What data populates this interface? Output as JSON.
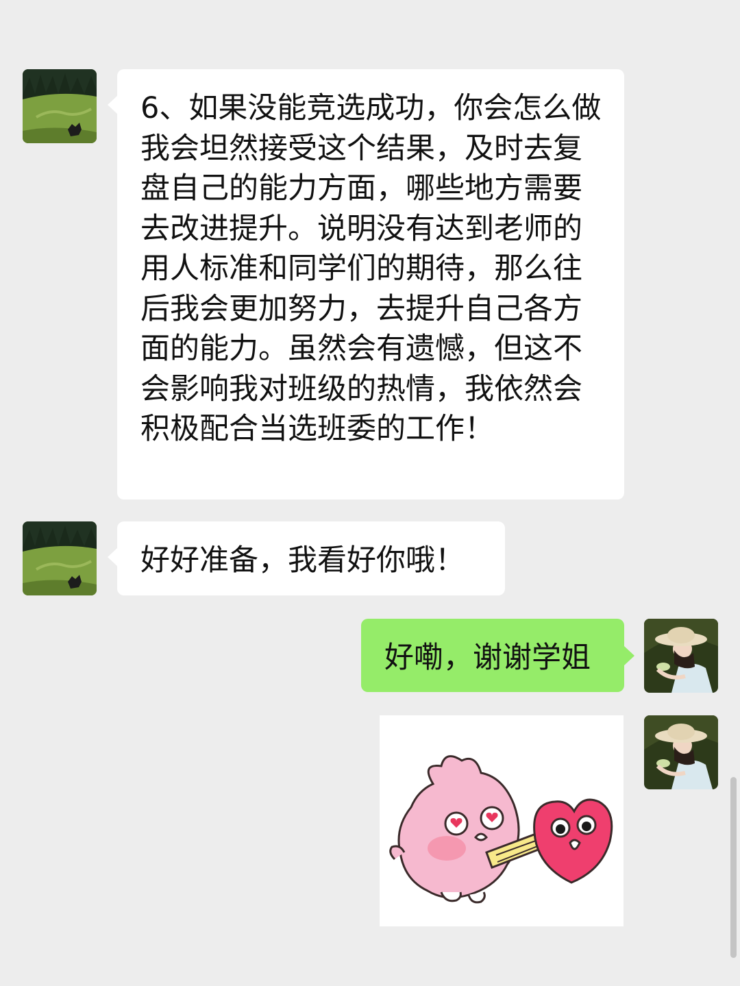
{
  "messages": [
    {
      "sender": "other",
      "text": "6、如果没能竞选成功，你会怎么做\n我会坦然接受这个结果，及时去复盘自己的能力方面，哪些地方需要去改进提升。说明没有达到老师的用人标准和同学们的期待，那么往后我会更加努力，去提升自己各方面的能力。虽然会有遗憾，但这不会影响我对班级的热情，我依然会积极配合当选班委的工作！"
    },
    {
      "sender": "other",
      "text": "好好准备，我看好你哦！"
    },
    {
      "sender": "self",
      "text": "好嘞，谢谢学姐"
    },
    {
      "sender": "self",
      "type": "sticker",
      "sticker_icon": "pink-bunny-with-heart-sticker"
    }
  ],
  "colors": {
    "background": "#ededed",
    "incoming_bubble": "#ffffff",
    "outgoing_bubble": "#95ec69"
  }
}
